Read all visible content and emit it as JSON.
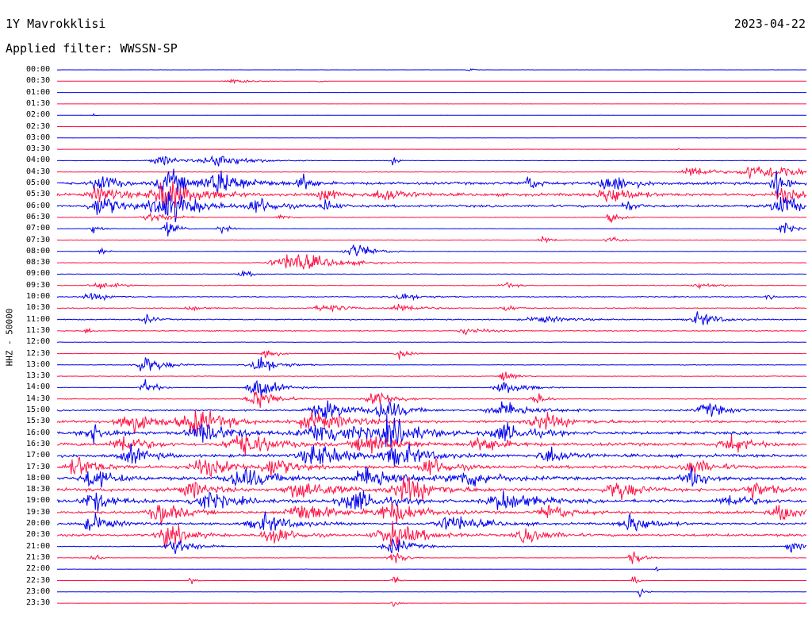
{
  "header": {
    "station": "1Y Mavrokklisi",
    "date": "2023-04-22",
    "filter": "Applied filter: WWSSN-SP"
  },
  "channel_label": "HHZ - 50000",
  "colors": {
    "trace_a": "#0000ee",
    "trace_b": "#ff1144",
    "text": "#000000",
    "background": "#ffffff"
  },
  "chart_data": {
    "type": "helicorder",
    "title": "1Y Mavrokklisi",
    "subtitle": "Applied filter: WWSSN-SP",
    "ylabel": "HHZ - 50000",
    "date": "2023-04-22",
    "row_interval_minutes": 30,
    "trace_colors": [
      "#0000ee",
      "#ff1144"
    ],
    "rows": [
      {
        "label": "00:00",
        "amp": 0.1,
        "bursts": [
          {
            "x": 0.55,
            "w": 0.004,
            "a": 3
          }
        ]
      },
      {
        "label": "00:30",
        "amp": 0.05,
        "bursts": [
          {
            "x": 0.24,
            "w": 0.02,
            "a": 3
          },
          {
            "x": 0.35,
            "w": 0.004,
            "a": 2
          }
        ]
      },
      {
        "label": "01:00",
        "amp": 0.06,
        "bursts": []
      },
      {
        "label": "01:30",
        "amp": 0.06,
        "bursts": []
      },
      {
        "label": "02:00",
        "amp": 0.06,
        "bursts": [
          {
            "x": 0.05,
            "w": 0.003,
            "a": 3
          }
        ]
      },
      {
        "label": "02:30",
        "amp": 0.08,
        "bursts": []
      },
      {
        "label": "03:00",
        "amp": 0.12,
        "bursts": []
      },
      {
        "label": "03:30",
        "amp": 0.15,
        "bursts": [
          {
            "x": 0.83,
            "w": 0.004,
            "a": 2
          }
        ]
      },
      {
        "label": "04:00",
        "amp": 0.25,
        "bursts": [
          {
            "x": 0.14,
            "w": 0.02,
            "a": 6
          },
          {
            "x": 0.22,
            "w": 0.03,
            "a": 8
          },
          {
            "x": 0.45,
            "w": 0.006,
            "a": 5
          }
        ]
      },
      {
        "label": "04:30",
        "amp": 0.3,
        "bursts": [
          {
            "x": 0.85,
            "w": 0.02,
            "a": 8
          },
          {
            "x": 0.93,
            "w": 0.02,
            "a": 10
          },
          {
            "x": 0.97,
            "w": 0.03,
            "a": 6
          }
        ]
      },
      {
        "label": "05:00",
        "amp": 1.4,
        "bursts": [
          {
            "x": 0.06,
            "w": 0.015,
            "a": 12
          },
          {
            "x": 0.15,
            "w": 0.02,
            "a": 16
          },
          {
            "x": 0.22,
            "w": 0.03,
            "a": 14
          },
          {
            "x": 0.33,
            "w": 0.01,
            "a": 10
          },
          {
            "x": 0.63,
            "w": 0.01,
            "a": 9
          },
          {
            "x": 0.74,
            "w": 0.02,
            "a": 12
          },
          {
            "x": 0.96,
            "w": 0.01,
            "a": 16
          }
        ]
      },
      {
        "label": "05:30",
        "amp": 1.5,
        "bursts": [
          {
            "x": 0.06,
            "w": 0.02,
            "a": 10
          },
          {
            "x": 0.15,
            "w": 0.03,
            "a": 18
          },
          {
            "x": 0.36,
            "w": 0.015,
            "a": 8
          },
          {
            "x": 0.44,
            "w": 0.02,
            "a": 9
          },
          {
            "x": 0.74,
            "w": 0.02,
            "a": 12
          },
          {
            "x": 0.97,
            "w": 0.015,
            "a": 10
          }
        ]
      },
      {
        "label": "06:00",
        "amp": 1.2,
        "bursts": [
          {
            "x": 0.06,
            "w": 0.02,
            "a": 14
          },
          {
            "x": 0.15,
            "w": 0.03,
            "a": 18
          },
          {
            "x": 0.27,
            "w": 0.02,
            "a": 10
          },
          {
            "x": 0.36,
            "w": 0.01,
            "a": 8
          },
          {
            "x": 0.76,
            "w": 0.01,
            "a": 7
          },
          {
            "x": 0.97,
            "w": 0.02,
            "a": 14
          }
        ]
      },
      {
        "label": "06:30",
        "amp": 0.3,
        "bursts": [
          {
            "x": 0.13,
            "w": 0.02,
            "a": 6
          },
          {
            "x": 0.3,
            "w": 0.008,
            "a": 5
          },
          {
            "x": 0.74,
            "w": 0.01,
            "a": 6
          }
        ]
      },
      {
        "label": "07:00",
        "amp": 0.25,
        "bursts": [
          {
            "x": 0.05,
            "w": 0.008,
            "a": 6
          },
          {
            "x": 0.15,
            "w": 0.01,
            "a": 10
          },
          {
            "x": 0.22,
            "w": 0.008,
            "a": 6
          },
          {
            "x": 0.97,
            "w": 0.01,
            "a": 8
          }
        ]
      },
      {
        "label": "07:30",
        "amp": 0.2,
        "bursts": [
          {
            "x": 0.65,
            "w": 0.01,
            "a": 5
          },
          {
            "x": 0.74,
            "w": 0.01,
            "a": 6
          }
        ]
      },
      {
        "label": "08:00",
        "amp": 0.25,
        "bursts": [
          {
            "x": 0.06,
            "w": 0.005,
            "a": 6
          },
          {
            "x": 0.4,
            "w": 0.02,
            "a": 9
          }
        ]
      },
      {
        "label": "08:30",
        "amp": 0.3,
        "bursts": [
          {
            "x": 0.32,
            "w": 0.04,
            "a": 12
          }
        ]
      },
      {
        "label": "09:00",
        "amp": 0.35,
        "bursts": [
          {
            "x": 0.25,
            "w": 0.01,
            "a": 4
          }
        ]
      },
      {
        "label": "09:30",
        "amp": 0.45,
        "bursts": [
          {
            "x": 0.06,
            "w": 0.02,
            "a": 4
          },
          {
            "x": 0.6,
            "w": 0.01,
            "a": 4
          },
          {
            "x": 0.86,
            "w": 0.02,
            "a": 3
          }
        ]
      },
      {
        "label": "10:00",
        "amp": 0.5,
        "bursts": [
          {
            "x": 0.05,
            "w": 0.02,
            "a": 4
          },
          {
            "x": 0.46,
            "w": 0.02,
            "a": 5
          },
          {
            "x": 0.95,
            "w": 0.005,
            "a": 4
          }
        ]
      },
      {
        "label": "10:30",
        "amp": 0.55,
        "bursts": [
          {
            "x": 0.18,
            "w": 0.01,
            "a": 4
          },
          {
            "x": 0.36,
            "w": 0.02,
            "a": 5
          },
          {
            "x": 0.46,
            "w": 0.02,
            "a": 5
          },
          {
            "x": 0.6,
            "w": 0.01,
            "a": 4
          }
        ]
      },
      {
        "label": "11:00",
        "amp": 0.6,
        "bursts": [
          {
            "x": 0.12,
            "w": 0.01,
            "a": 5
          },
          {
            "x": 0.65,
            "w": 0.03,
            "a": 4
          },
          {
            "x": 0.86,
            "w": 0.02,
            "a": 8
          }
        ]
      },
      {
        "label": "11:30",
        "amp": 0.5,
        "bursts": [
          {
            "x": 0.04,
            "w": 0.005,
            "a": 4
          },
          {
            "x": 0.55,
            "w": 0.02,
            "a": 4
          }
        ]
      },
      {
        "label": "12:00",
        "amp": 0.25,
        "bursts": []
      },
      {
        "label": "12:30",
        "amp": 0.25,
        "bursts": [
          {
            "x": 0.28,
            "w": 0.01,
            "a": 8
          },
          {
            "x": 0.46,
            "w": 0.01,
            "a": 8
          }
        ]
      },
      {
        "label": "13:00",
        "amp": 0.3,
        "bursts": [
          {
            "x": 0.12,
            "w": 0.02,
            "a": 10
          },
          {
            "x": 0.27,
            "w": 0.02,
            "a": 12
          }
        ]
      },
      {
        "label": "13:30",
        "amp": 0.3,
        "bursts": [
          {
            "x": 0.6,
            "w": 0.01,
            "a": 8
          }
        ]
      },
      {
        "label": "14:00",
        "amp": 0.35,
        "bursts": [
          {
            "x": 0.12,
            "w": 0.01,
            "a": 10
          },
          {
            "x": 0.27,
            "w": 0.02,
            "a": 12
          },
          {
            "x": 0.6,
            "w": 0.02,
            "a": 8
          }
        ]
      },
      {
        "label": "14:30",
        "amp": 0.4,
        "bursts": [
          {
            "x": 0.27,
            "w": 0.02,
            "a": 12
          },
          {
            "x": 0.43,
            "w": 0.02,
            "a": 10
          },
          {
            "x": 0.64,
            "w": 0.01,
            "a": 8
          }
        ]
      },
      {
        "label": "15:00",
        "amp": 0.9,
        "bursts": [
          {
            "x": 0.36,
            "w": 0.03,
            "a": 10
          },
          {
            "x": 0.44,
            "w": 0.02,
            "a": 12
          },
          {
            "x": 0.6,
            "w": 0.03,
            "a": 9
          },
          {
            "x": 0.87,
            "w": 0.02,
            "a": 8
          }
        ]
      },
      {
        "label": "15:30",
        "amp": 1.3,
        "bursts": [
          {
            "x": 0.1,
            "w": 0.03,
            "a": 12
          },
          {
            "x": 0.19,
            "w": 0.03,
            "a": 14
          },
          {
            "x": 0.35,
            "w": 0.04,
            "a": 10
          },
          {
            "x": 0.65,
            "w": 0.03,
            "a": 9
          }
        ]
      },
      {
        "label": "16:00",
        "amp": 1.5,
        "bursts": [
          {
            "x": 0.05,
            "w": 0.02,
            "a": 10
          },
          {
            "x": 0.2,
            "w": 0.03,
            "a": 12
          },
          {
            "x": 0.36,
            "w": 0.04,
            "a": 14
          },
          {
            "x": 0.45,
            "w": 0.03,
            "a": 14
          },
          {
            "x": 0.6,
            "w": 0.03,
            "a": 10
          }
        ]
      },
      {
        "label": "16:30",
        "amp": 1.6,
        "bursts": [
          {
            "x": 0.09,
            "w": 0.02,
            "a": 12
          },
          {
            "x": 0.25,
            "w": 0.03,
            "a": 14
          },
          {
            "x": 0.42,
            "w": 0.03,
            "a": 12
          },
          {
            "x": 0.57,
            "w": 0.02,
            "a": 10
          },
          {
            "x": 0.9,
            "w": 0.02,
            "a": 10
          }
        ]
      },
      {
        "label": "17:00",
        "amp": 1.6,
        "bursts": [
          {
            "x": 0.1,
            "w": 0.02,
            "a": 10
          },
          {
            "x": 0.35,
            "w": 0.03,
            "a": 14
          },
          {
            "x": 0.46,
            "w": 0.03,
            "a": 12
          },
          {
            "x": 0.66,
            "w": 0.02,
            "a": 10
          }
        ]
      },
      {
        "label": "17:30",
        "amp": 1.6,
        "bursts": [
          {
            "x": 0.03,
            "w": 0.02,
            "a": 12
          },
          {
            "x": 0.2,
            "w": 0.03,
            "a": 10
          },
          {
            "x": 0.29,
            "w": 0.02,
            "a": 12
          },
          {
            "x": 0.5,
            "w": 0.02,
            "a": 12
          },
          {
            "x": 0.85,
            "w": 0.02,
            "a": 10
          }
        ]
      },
      {
        "label": "18:00",
        "amp": 1.7,
        "bursts": [
          {
            "x": 0.05,
            "w": 0.02,
            "a": 12
          },
          {
            "x": 0.25,
            "w": 0.03,
            "a": 12
          },
          {
            "x": 0.42,
            "w": 0.03,
            "a": 14
          },
          {
            "x": 0.55,
            "w": 0.03,
            "a": 10
          },
          {
            "x": 0.85,
            "w": 0.02,
            "a": 10
          }
        ]
      },
      {
        "label": "18:30",
        "amp": 1.7,
        "bursts": [
          {
            "x": 0.18,
            "w": 0.02,
            "a": 10
          },
          {
            "x": 0.33,
            "w": 0.03,
            "a": 12
          },
          {
            "x": 0.47,
            "w": 0.03,
            "a": 14
          },
          {
            "x": 0.75,
            "w": 0.02,
            "a": 12
          },
          {
            "x": 0.93,
            "w": 0.02,
            "a": 10
          }
        ]
      },
      {
        "label": "19:00",
        "amp": 1.6,
        "bursts": [
          {
            "x": 0.05,
            "w": 0.02,
            "a": 12
          },
          {
            "x": 0.2,
            "w": 0.03,
            "a": 10
          },
          {
            "x": 0.4,
            "w": 0.03,
            "a": 12
          },
          {
            "x": 0.6,
            "w": 0.03,
            "a": 12
          },
          {
            "x": 0.9,
            "w": 0.02,
            "a": 8
          }
        ]
      },
      {
        "label": "19:30",
        "amp": 1.4,
        "bursts": [
          {
            "x": 0.14,
            "w": 0.02,
            "a": 14
          },
          {
            "x": 0.33,
            "w": 0.03,
            "a": 12
          },
          {
            "x": 0.45,
            "w": 0.03,
            "a": 12
          },
          {
            "x": 0.66,
            "w": 0.02,
            "a": 10
          },
          {
            "x": 0.97,
            "w": 0.02,
            "a": 10
          }
        ]
      },
      {
        "label": "20:00",
        "amp": 1.2,
        "bursts": [
          {
            "x": 0.05,
            "w": 0.02,
            "a": 10
          },
          {
            "x": 0.28,
            "w": 0.03,
            "a": 10
          },
          {
            "x": 0.53,
            "w": 0.03,
            "a": 10
          },
          {
            "x": 0.77,
            "w": 0.02,
            "a": 12
          }
        ]
      },
      {
        "label": "20:30",
        "amp": 1.3,
        "bursts": [
          {
            "x": 0.15,
            "w": 0.02,
            "a": 14
          },
          {
            "x": 0.29,
            "w": 0.02,
            "a": 12
          },
          {
            "x": 0.45,
            "w": 0.03,
            "a": 14
          },
          {
            "x": 0.63,
            "w": 0.02,
            "a": 10
          }
        ]
      },
      {
        "label": "21:00",
        "amp": 0.4,
        "bursts": [
          {
            "x": 0.16,
            "w": 0.02,
            "a": 10
          },
          {
            "x": 0.45,
            "w": 0.02,
            "a": 10
          },
          {
            "x": 0.98,
            "w": 0.01,
            "a": 8
          }
        ]
      },
      {
        "label": "21:30",
        "amp": 0.25,
        "bursts": [
          {
            "x": 0.05,
            "w": 0.005,
            "a": 8
          },
          {
            "x": 0.45,
            "w": 0.01,
            "a": 10
          },
          {
            "x": 0.77,
            "w": 0.01,
            "a": 8
          }
        ]
      },
      {
        "label": "22:00",
        "amp": 0.15,
        "bursts": [
          {
            "x": 0.8,
            "w": 0.003,
            "a": 3
          }
        ]
      },
      {
        "label": "22:30",
        "amp": 0.12,
        "bursts": [
          {
            "x": 0.18,
            "w": 0.005,
            "a": 6
          },
          {
            "x": 0.45,
            "w": 0.005,
            "a": 6
          },
          {
            "x": 0.77,
            "w": 0.005,
            "a": 6
          }
        ]
      },
      {
        "label": "23:00",
        "amp": 0.1,
        "bursts": [
          {
            "x": 0.78,
            "w": 0.005,
            "a": 8
          }
        ]
      },
      {
        "label": "23:30",
        "amp": 0.1,
        "bursts": [
          {
            "x": 0.45,
            "w": 0.005,
            "a": 6
          }
        ]
      }
    ]
  }
}
